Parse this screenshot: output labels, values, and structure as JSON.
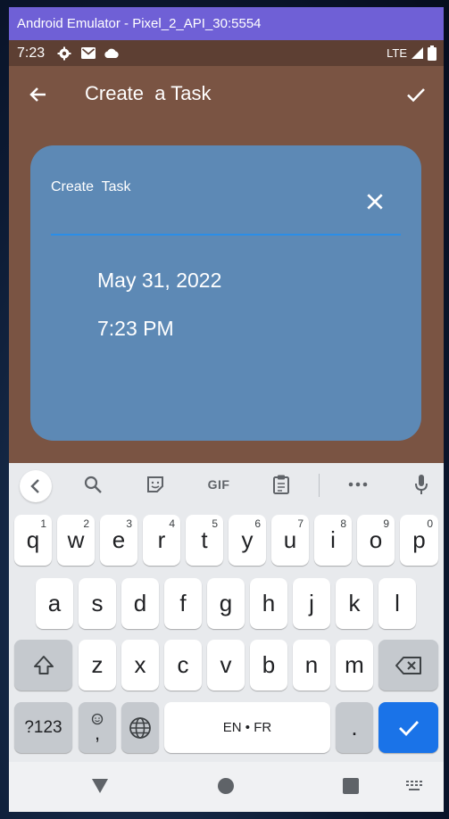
{
  "emulator": {
    "title": "Android Emulator - Pixel_2_API_30:5554"
  },
  "status_bar": {
    "time": "7:23",
    "network": "LTE",
    "icons": [
      "gear-icon",
      "gmail-icon",
      "cloud-icon",
      "signal-icon",
      "battery-icon"
    ]
  },
  "app_bar": {
    "title": "Create  a Task",
    "back_icon": "arrow-back-icon",
    "confirm_icon": "checkmark-icon"
  },
  "card": {
    "label": "Create  Task",
    "close_icon": "close-icon",
    "date": "May 31, 2022",
    "time": "7:23 PM",
    "background_color": "#5d89b5",
    "accent_color": "#2a8ee8"
  },
  "keyboard": {
    "toolbar": {
      "collapse_icon": "chevron-left-icon",
      "search_icon": "search-icon",
      "sticker_icon": "sticker-icon",
      "gif_label": "GIF",
      "clipboard_icon": "clipboard-icon",
      "more_icon": "more-horizontal-icon",
      "mic_icon": "microphone-icon"
    },
    "row1": [
      {
        "key": "q",
        "hint": "1"
      },
      {
        "key": "w",
        "hint": "2"
      },
      {
        "key": "e",
        "hint": "3"
      },
      {
        "key": "r",
        "hint": "4"
      },
      {
        "key": "t",
        "hint": "5"
      },
      {
        "key": "y",
        "hint": "6"
      },
      {
        "key": "u",
        "hint": "7"
      },
      {
        "key": "i",
        "hint": "8"
      },
      {
        "key": "o",
        "hint": "9"
      },
      {
        "key": "p",
        "hint": "0"
      }
    ],
    "row2": [
      "a",
      "s",
      "d",
      "f",
      "g",
      "h",
      "j",
      "k",
      "l"
    ],
    "row3": [
      "z",
      "x",
      "c",
      "v",
      "b",
      "n",
      "m"
    ],
    "bottom": {
      "symbols_label": "?123",
      "comma_label": ",",
      "emoji_icon": "emoji-icon",
      "globe_icon": "globe-icon",
      "space_label": "EN • FR",
      "period_label": ".",
      "enter_icon": "checkmark-icon",
      "shift_icon": "shift-icon",
      "backspace_icon": "backspace-icon"
    },
    "enter_color": "#1a73e8"
  },
  "nav_bar": {
    "back_icon": "nav-back-icon",
    "home_icon": "nav-home-icon",
    "recents_icon": "nav-recents-icon",
    "keyboard_switch_icon": "keyboard-icon"
  }
}
